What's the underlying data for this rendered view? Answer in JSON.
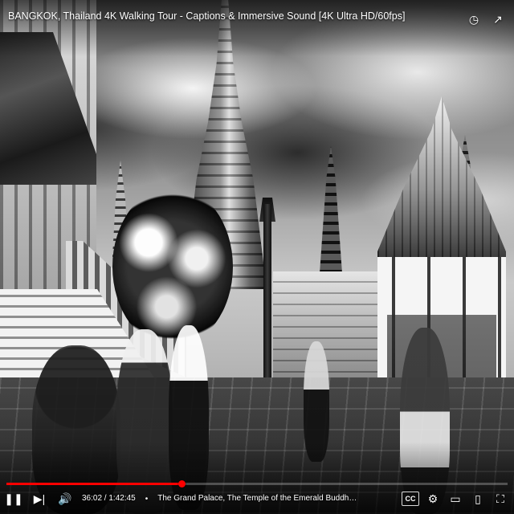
{
  "video": {
    "title": "BANGKOK, Thailand 4K Walking Tour - Captions & Immersive Sound [4K Ultra HD/60fps]",
    "current_time": "36:02",
    "total_time": "1:42:45",
    "chapter_text": "The Grand Palace, The Temple of the Emerald Buddha, Chakri Maha Prasat Throne Hall, etc.",
    "progress_fraction": 0.35
  },
  "icons": {
    "watch_later": "clock-icon",
    "share": "share-icon",
    "play_pause": "pause-icon",
    "next": "next-icon",
    "volume": "volume-icon",
    "captions": "captions-icon",
    "settings": "settings-icon",
    "miniplayer": "miniplayer-icon",
    "theater": "theater-icon",
    "fullscreen": "fullscreen-icon"
  },
  "ui_text": {
    "time_separator": " / ",
    "chapter_separator": "•",
    "captions_label": "CC"
  },
  "colors": {
    "progress": "#ff0000",
    "text": "#ffffff"
  }
}
